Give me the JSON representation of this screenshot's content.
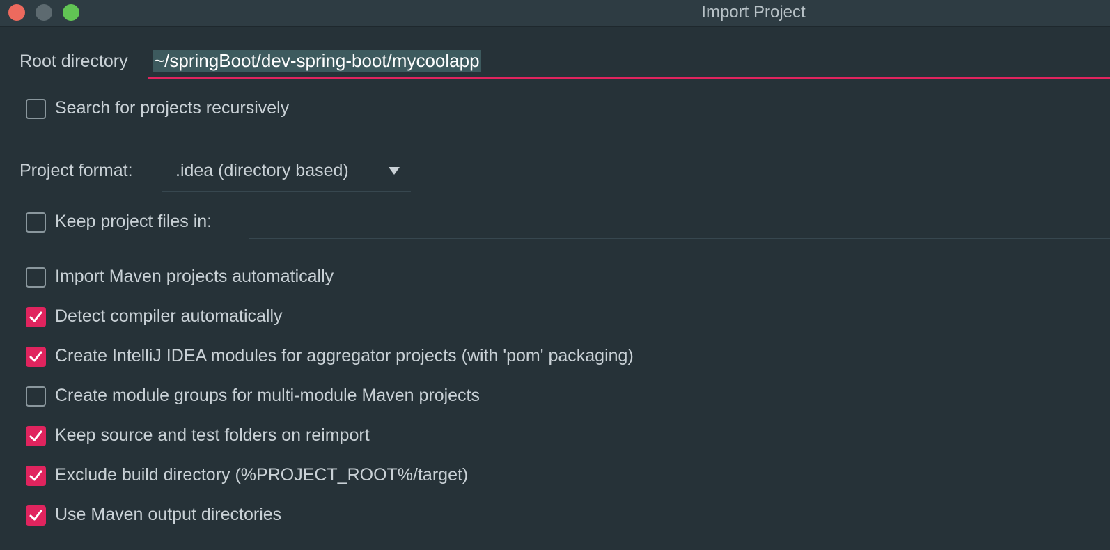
{
  "window": {
    "title": "Import Project"
  },
  "root_directory": {
    "label": "Root directory",
    "value": "~/springBoot/dev-spring-boot/mycoolapp"
  },
  "project_format": {
    "label": "Project format:",
    "selected": ".idea (directory based)"
  },
  "options": [
    {
      "label": "Search for projects recursively",
      "checked": false
    },
    {
      "label": "Keep project files in:",
      "checked": false
    },
    {
      "label": "Import Maven projects automatically",
      "checked": false
    },
    {
      "label": "Detect compiler automatically",
      "checked": true
    },
    {
      "label": "Create IntelliJ IDEA modules for aggregator projects (with 'pom' packaging)",
      "checked": true
    },
    {
      "label": "Create module groups for multi-module Maven projects",
      "checked": false
    },
    {
      "label": "Keep source and test folders on reimport",
      "checked": true
    },
    {
      "label": "Exclude build directory (%PROJECT_ROOT%/target)",
      "checked": true
    },
    {
      "label": "Use Maven output directories",
      "checked": true
    }
  ],
  "colors": {
    "background": "#263238",
    "accent": "#e0245e",
    "text": "#c9d1d6"
  }
}
